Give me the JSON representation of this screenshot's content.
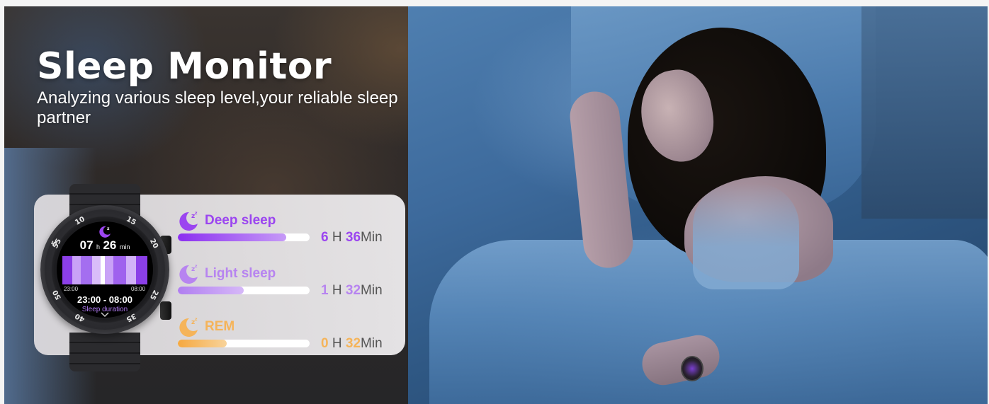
{
  "headline": "Sleep Monitor",
  "subtitle": "Analyzing various sleep level,your reliable sleep partner",
  "colors": {
    "deep": "#9b45f0",
    "light": "#b784f0",
    "rem": "#f5b45a"
  },
  "metrics": {
    "deep": {
      "label": "Deep sleep",
      "hours": "6",
      "h_unit": "H",
      "minutes": "36",
      "m_unit": "Min",
      "level": 0.82,
      "icon": "crescent-moon-zz-icon"
    },
    "light": {
      "label": "Light sleep",
      "hours": "1",
      "h_unit": "H",
      "minutes": "32",
      "m_unit": "Min",
      "level": 0.5,
      "icon": "crescent-moon-zz-icon"
    },
    "rem": {
      "label": "REM",
      "hours": "0",
      "h_unit": "H",
      "minutes": "32",
      "m_unit": "Min",
      "level": 0.37,
      "icon": "crescent-moon-zz-icon"
    }
  },
  "watch": {
    "hours": "07",
    "h_unit": "h",
    "minutes": "26",
    "m_unit": "min",
    "start_tick": "23:00",
    "end_tick": "08:00",
    "range": "23:00 - 08:00",
    "caption": "Sleep duration",
    "bezel": [
      "5",
      "10",
      "15",
      "20",
      "25",
      "35",
      "40",
      "50",
      "55"
    ]
  }
}
